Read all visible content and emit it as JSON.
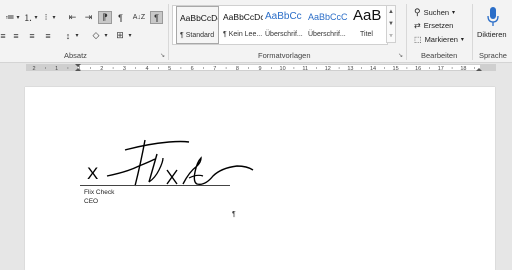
{
  "ribbon": {
    "groups": {
      "paragraph": "Absatz",
      "styles": "Formatvorlagen",
      "editing": "Bearbeiten",
      "voice": "Sprache"
    },
    "styles_gallery": [
      {
        "preview": "AaBbCcDc",
        "name": "¶ Standard",
        "selected": true
      },
      {
        "preview": "AaBbCcDc",
        "name": "¶ Kein Lee...",
        "selected": false
      },
      {
        "preview": "AaBbCc",
        "name": "Überschrif...",
        "selected": false
      },
      {
        "preview": "AaBbCcC",
        "name": "Überschrif...",
        "selected": false
      },
      {
        "preview": "AaB",
        "name": "Titel",
        "selected": false
      }
    ],
    "editing": {
      "find": "Suchen",
      "replace": "Ersetzen",
      "select": "Markieren"
    },
    "voice": {
      "dictate": "Diktieren"
    },
    "paragraph_icons": {
      "bullets": "≔",
      "numbering": "⒈",
      "multilevel": "⁝",
      "decrease_indent": "⇤",
      "increase_indent": "⇥",
      "text_direction_ltr": "⁋",
      "text_direction_rtl": "¶",
      "sort": "A↓Z",
      "show_marks": "¶",
      "align_left": "≡",
      "align_center": "≡",
      "align_right": "≡",
      "justify": "≡",
      "line_spacing": "↕",
      "shading": "◇",
      "borders": "⊞",
      "launcher": "↘"
    }
  },
  "ruler": {
    "labels": [
      "2",
      "1",
      "1",
      "2",
      "3",
      "4",
      "5",
      "6",
      "7",
      "8",
      "9",
      "10",
      "11",
      "12",
      "13",
      "14",
      "15",
      "16",
      "17",
      "18"
    ]
  },
  "document": {
    "signature_x": "X",
    "signer_name": "Flix Check",
    "signer_title": "CEO",
    "pilcrow": "¶"
  },
  "colors": {
    "ribbon_bg": "#f3f3f3",
    "canvas_bg": "#e6e6e6",
    "accent_blue": "#2b6ec8"
  }
}
